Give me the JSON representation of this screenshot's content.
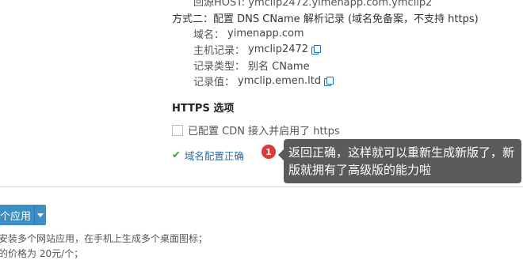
{
  "method1_cut_line": "回源HOST: ymclip2472.yimenapp.com.ymclip2",
  "method2": {
    "title": "方式二：配置 DNS CName 解析记录 (域名免备案，不支持 https)",
    "domain_label": "域名：",
    "domain_value": "yimenapp.com",
    "host_label": "主机记录：",
    "host_value": "ymclip2472",
    "type_label": "记录类型：",
    "type_value": "别名 CName",
    "record_label": "记录值：",
    "record_value": "ymclip.emen.ltd"
  },
  "https": {
    "heading": "HTTPS 选项",
    "cdn_checkbox_label": "已配置 CDN 接入并启用了 https",
    "cdn_checked": false
  },
  "status": {
    "ok_text": "域名配置正确"
  },
  "tooltip": {
    "badge": "1",
    "text": "返回正确，这样就可以重新生成新版了，新版就拥有了高级版的能力啦"
  },
  "bottom": {
    "app_button_label": "个应用",
    "desc_line1": "安装多个网站应用，在手机上生成多个桌面图标；",
    "desc_line2": "的价格为 20元/个；"
  }
}
